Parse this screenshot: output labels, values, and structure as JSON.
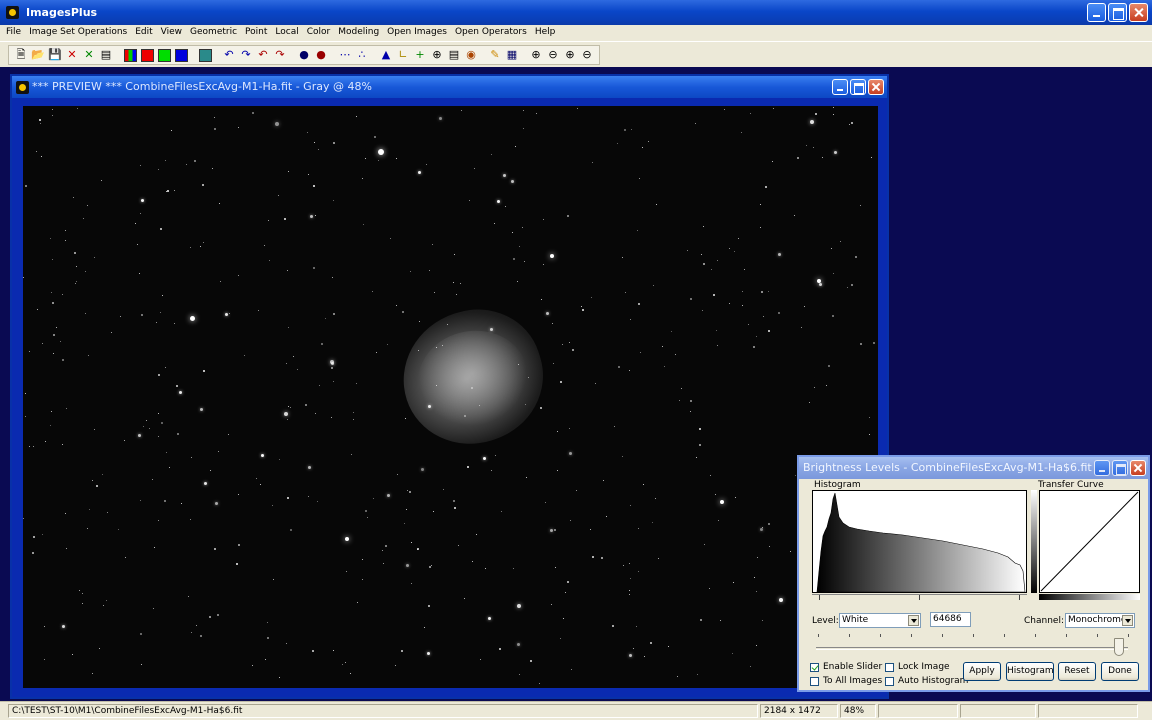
{
  "app": {
    "title": "ImagesPlus"
  },
  "menu": [
    "File",
    "Image Set Operations",
    "Edit",
    "View",
    "Geometric",
    "Point",
    "Local",
    "Color",
    "Modeling",
    "Open Images",
    "Open Operators",
    "Help"
  ],
  "toolbar_icons": [
    "new-icon",
    "open-icon",
    "save-icon",
    "close-image-icon",
    "close-all-icon",
    "print-icon",
    "rgb-icon",
    "red-channel-icon",
    "green-channel-icon",
    "blue-channel-icon",
    "image-icon",
    "undo-icon",
    "redo-icon",
    "undo-all-icon",
    "redo-all-icon",
    "point-icon",
    "record-icon",
    "selection-icon",
    "graph-icon",
    "histogram-icon",
    "crop-icon",
    "crosshair-icon",
    "cross-icon",
    "info-icon",
    "paint-icon",
    "pencil-icon",
    "grid-icon",
    "zoom-in-icon",
    "zoom-out-icon",
    "zoom-fit-icon",
    "zoom-actual-icon"
  ],
  "preview": {
    "title": "*** PREVIEW *** CombineFilesExcAvg-M1-Ha.fit - Gray @ 48%"
  },
  "dialog": {
    "title": "Brightness Levels - CombineFilesExcAvg-M1-Ha$6.fit",
    "histogram_label": "Histogram",
    "transfer_label": "Transfer Curve",
    "level_label": "Level:",
    "level_value": "White",
    "level_number": "64686",
    "channel_label": "Channel:",
    "channel_value": "Monochrome",
    "slider_fraction": 0.97,
    "checks": {
      "enable_slider": {
        "label": "Enable Slider",
        "checked": true
      },
      "to_all_images": {
        "label": "To All Images",
        "checked": false
      },
      "lock_image": {
        "label": "Lock Image",
        "checked": false
      },
      "auto_histogram": {
        "label": "Auto Histogram",
        "checked": false
      }
    },
    "buttons": {
      "apply": "Apply",
      "histogram": "Histogram",
      "reset": "Reset",
      "done": "Done"
    }
  },
  "status": {
    "path": "C:\\TEST\\ST-10\\M1\\CombineFilesExcAvg-M1-Ha$6.fit",
    "size": "2184 x 1472",
    "zoom": "48%"
  }
}
